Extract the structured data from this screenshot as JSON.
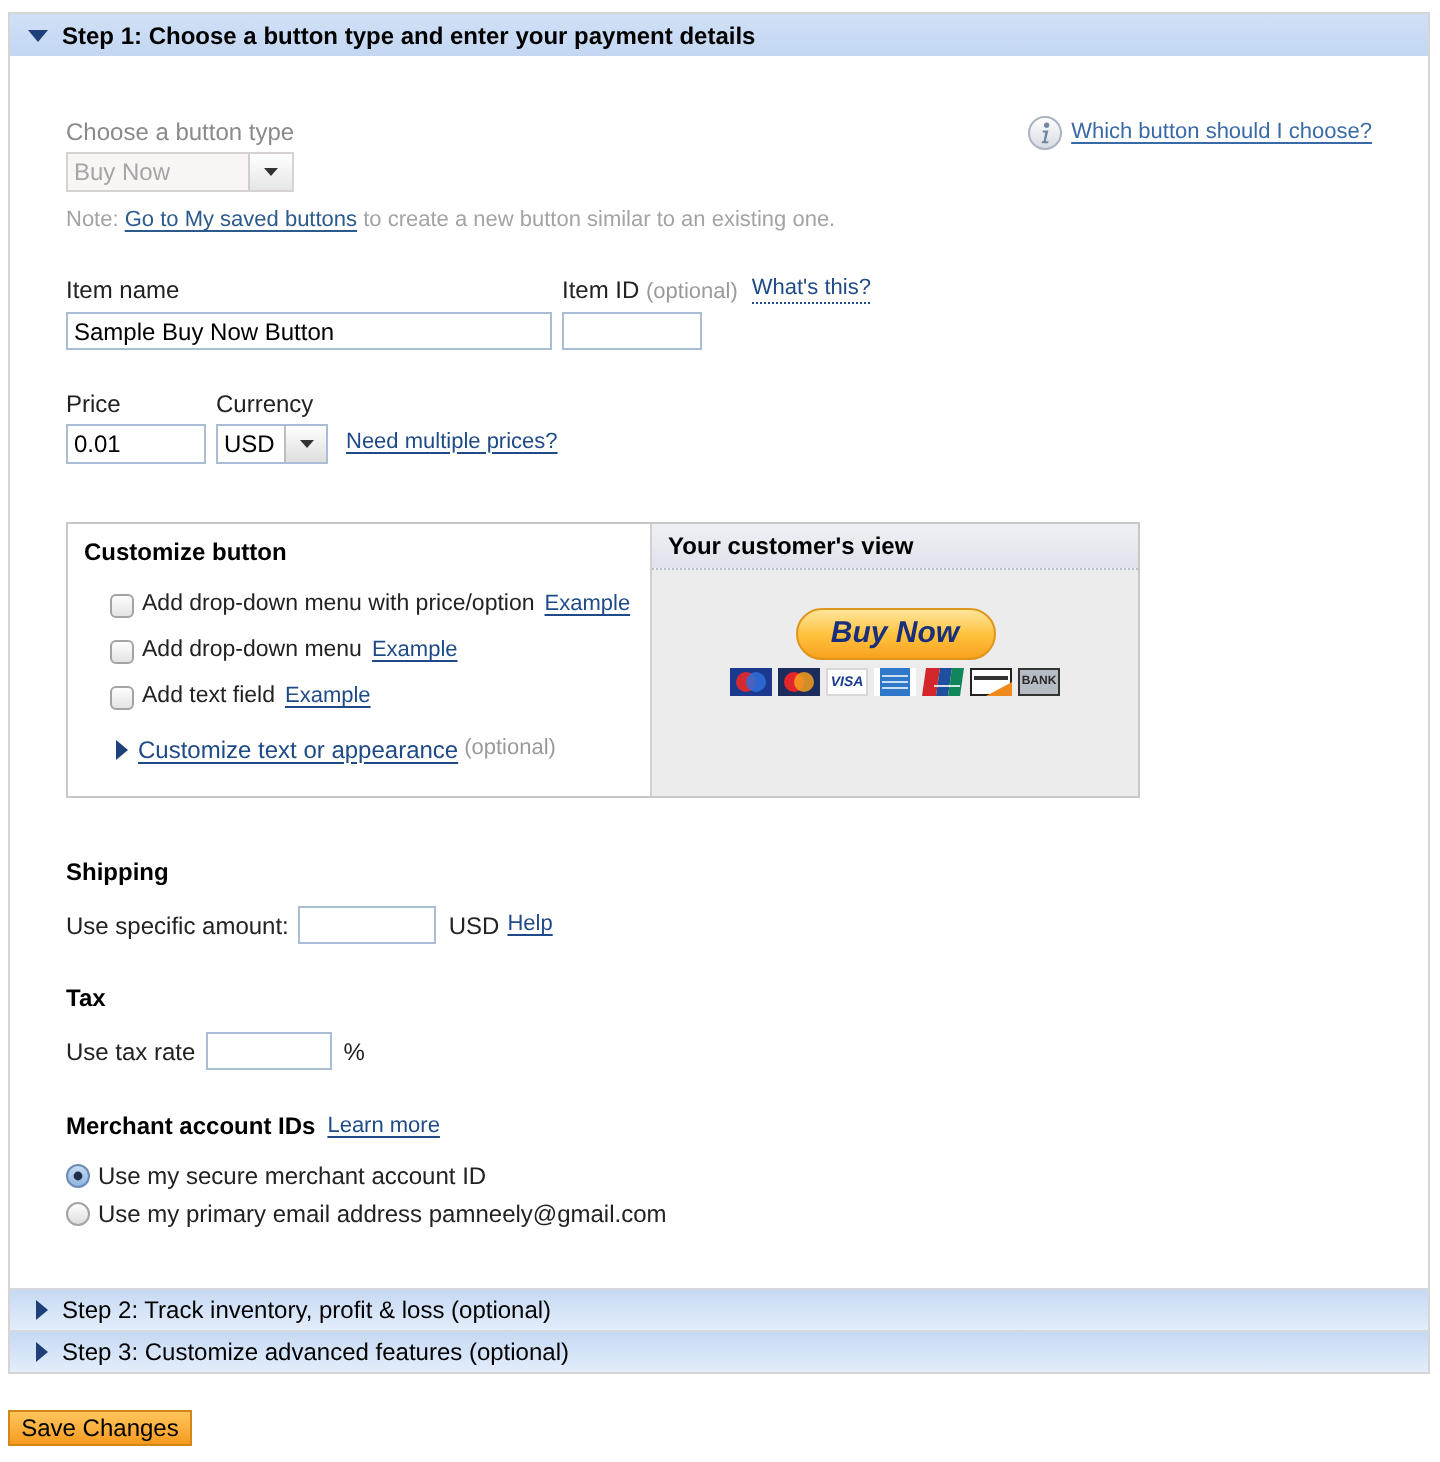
{
  "steps": [
    {
      "title": "Step 1: Choose a button type and enter your payment details",
      "expanded": true
    },
    {
      "title": "Step 2: Track inventory, profit & loss (optional)",
      "expanded": false
    },
    {
      "title": "Step 3: Customize advanced features (optional)",
      "expanded": false
    }
  ],
  "button_type": {
    "label": "Choose a button type",
    "value": "Buy Now",
    "disabled": true
  },
  "help_link": "Which button should I choose?",
  "note": {
    "prefix": "Note:",
    "link": "Go to My saved buttons",
    "suffix": "to create a new button similar to an existing one."
  },
  "item_name": {
    "label": "Item name",
    "value": "Sample Buy Now Button"
  },
  "item_id": {
    "label": "Item ID",
    "hint": "(optional)",
    "link": "What's this?"
  },
  "price": {
    "label": "Price",
    "value": "0.01"
  },
  "currency": {
    "label": "Currency",
    "value": "USD",
    "link": "Need multiple prices?"
  },
  "customize": {
    "title": "Customize button",
    "options": [
      {
        "label": "Add drop-down menu with price/option",
        "link": "Example",
        "checked": false
      },
      {
        "label": "Add drop-down menu",
        "link": "Example",
        "checked": false
      },
      {
        "label": "Add text field",
        "link": "Example",
        "checked": false
      }
    ],
    "more": {
      "label": "Customize text or appearance",
      "hint": "(optional)",
      "expanded": false
    }
  },
  "preview": {
    "title": "Your customer's view",
    "button": "Buy Now",
    "card_logos": [
      {
        "kind": "circles-dark"
      },
      {
        "kind": "circles"
      },
      {
        "kind": "wordmark",
        "text": "VISA"
      },
      {
        "kind": "tile"
      },
      {
        "kind": "stripes"
      },
      {
        "kind": "banner"
      },
      {
        "kind": "plate",
        "text": "BANK"
      }
    ]
  },
  "shipping": {
    "title": "Shipping",
    "label": "Use specific amount:",
    "unit": "USD",
    "link": "Help"
  },
  "tax": {
    "title": "Tax",
    "label": "Use tax rate",
    "unit": "%"
  },
  "merchant": {
    "title": "Merchant account IDs",
    "link": "Learn more",
    "options": [
      {
        "label": "Use my secure merchant account ID",
        "selected": true
      },
      {
        "label": "Use my primary email address pamneely@gmail.com",
        "selected": false
      }
    ]
  },
  "save_button": "Save Changes"
}
